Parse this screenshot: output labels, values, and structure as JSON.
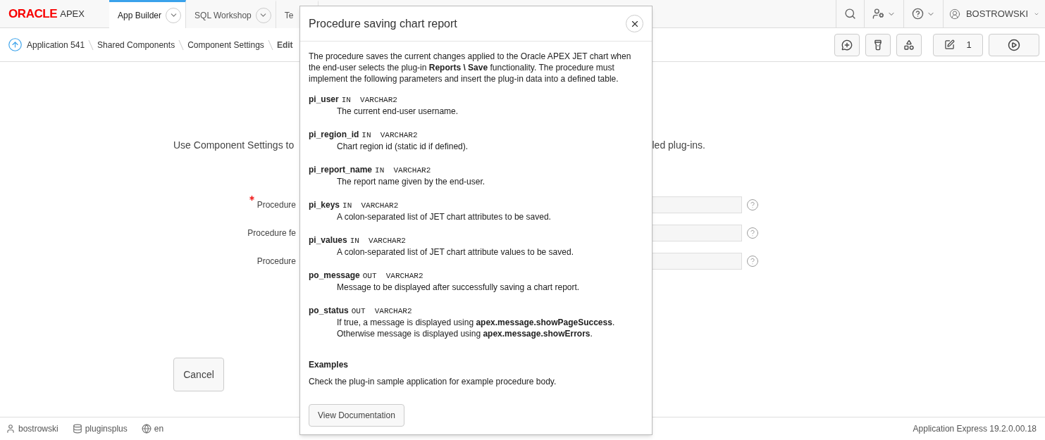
{
  "top_bar": {
    "logo": {
      "brand": "ORACLE",
      "product": "APEX"
    },
    "tabs": [
      {
        "label": "App Builder",
        "selected": true,
        "menu": true
      },
      {
        "label": "SQL Workshop",
        "selected": false,
        "menu": true
      },
      {
        "label": "Te",
        "selected": false,
        "menu": false
      }
    ],
    "user": "BOSTROWSKI"
  },
  "breadcrumb": {
    "items": [
      "Application 541",
      "Shared Components",
      "Component Settings"
    ],
    "current": "Edit"
  },
  "toolbar": {
    "edit_count": "1"
  },
  "page": {
    "intro_start": "Use Component Settings to",
    "intro_end": "led plug-ins.",
    "fields": [
      {
        "label": "Procedure",
        "required": true
      },
      {
        "label": "Procedure fe",
        "required": false
      },
      {
        "label": "Procedure",
        "required": false
      }
    ],
    "cancel": "Cancel"
  },
  "dialog": {
    "title": "Procedure saving chart report",
    "intro": "The procedure saves the current changes applied to the Oracle APEX JET chart when the end-user selects the plug-in **Reports \\ Save** functionality. The procedure must implement the following parameters and insert the plug-in data into a defined table.",
    "parameters": [
      {
        "name": "pi_user",
        "type": "IN  VARCHAR2",
        "description": "The current end-user username."
      },
      {
        "name": "pi_region_id",
        "type": "IN  VARCHAR2",
        "description": "Chart region id (static id if defined)."
      },
      {
        "name": "pi_report_name",
        "type": "IN  VARCHAR2",
        "description": "The report name given by the end-user."
      },
      {
        "name": "pi_keys",
        "type": "IN  VARCHAR2",
        "description": "A colon-separated list of JET chart attributes to be saved."
      },
      {
        "name": "pi_values",
        "type": "IN  VARCHAR2",
        "description": "A colon-separated list of JET chart attribute values to be saved."
      },
      {
        "name": "po_message",
        "type": "OUT  VARCHAR2",
        "description": "Message to be displayed after successfully saving a chart report."
      },
      {
        "name": "po_status",
        "type": "OUT  VARCHAR2",
        "description": "If true, a message is displayed using **apex.message.showPageSuccess**. Otherwise message is displayed using **apex.message.showErrors**."
      }
    ],
    "examples_heading": "Examples",
    "examples_text": "Check the plug-in sample application for example procedure body.",
    "button": "View Documentation"
  },
  "footer": {
    "user": "bostrowski",
    "workspace": "pluginsplus",
    "language": "en",
    "version": "Application Express 19.2.0.00.18"
  }
}
